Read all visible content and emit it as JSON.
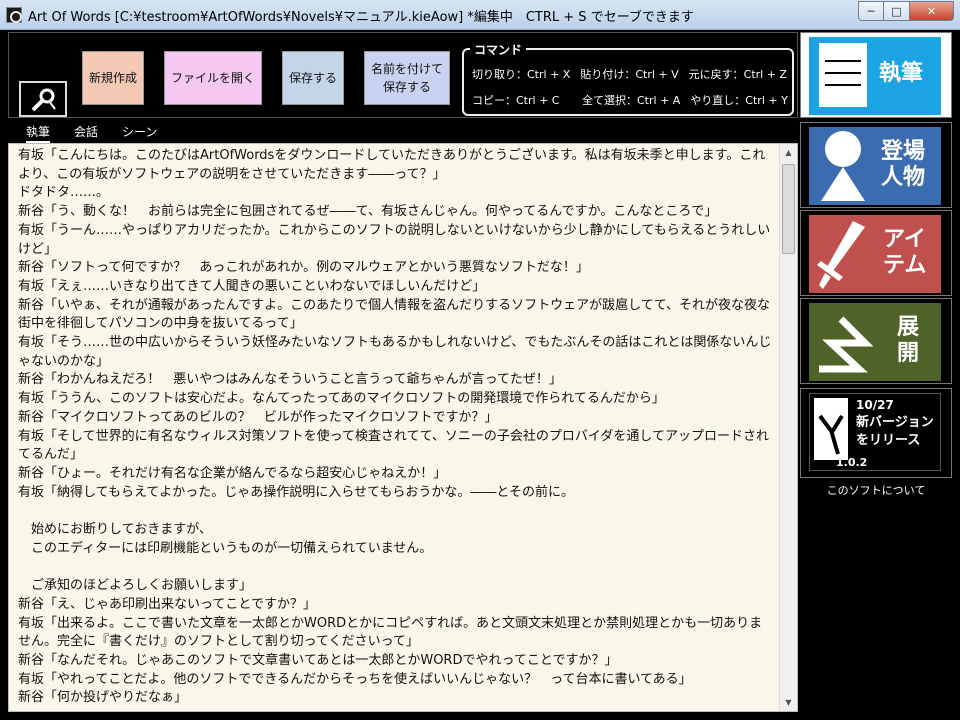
{
  "window": {
    "title": "Art Of Words [C:¥testroom¥ArtOfWords¥Novels¥マニュアル.kieAow] *編集中　CTRL + S でセーブできます",
    "min_label": "─",
    "max_label": "□",
    "close_label": "✕"
  },
  "toolbar": {
    "new_label": "新規作成",
    "open_label": "ファイルを開く",
    "save_label": "保存する",
    "saveas_label": "名前を付けて\n保存する"
  },
  "commands": {
    "title": "コマンド",
    "cut": "切り取り：Ctrl + X",
    "paste": "貼り付け：Ctrl + V",
    "undo": "元に戻す：Ctrl + Z",
    "copy": "コピー：Ctrl + C",
    "select_all": "全て選択：Ctrl + A",
    "redo": "やり直し：Ctrl + Y"
  },
  "tabs": [
    {
      "label": "執筆"
    },
    {
      "label": "会話"
    },
    {
      "label": "シーン"
    }
  ],
  "editor": {
    "text": "有坂「こんにちは。このたびはArtOfWordsをダウンロードしていただきありがとうございます。私は有坂未季と申します。これより、この有坂がソフトウェアの説明をさせていただきます――って？」\nドタドタ……。\n新谷「う、動くな！　お前らは完全に包囲されてるぜ――て、有坂さんじゃん。何やってるんですか。こんなところで」\n有坂「うーん……やっぱりアカリだったか。これからこのソフトの説明しないといけないから少し静かにしてもらえるとうれしいけど」\n新谷「ソフトって何ですか？　あっこれがあれか。例のマルウェアとかいう悪質なソフトだな！」\n有坂「えぇ……いきなり出てきて人聞きの悪いこといわないでほしいんだけど」\n新谷「いやぁ、それが通報があったんですよ。このあたりで個人情報を盗んだりするソフトウェアが跋扈してて、それが夜な夜な街中を徘徊してパソコンの中身を抜いてるって」\n有坂「そう……世の中広いからそういう妖怪みたいなソフトもあるかもしれないけど、でもたぶんその話はこれとは関係ないんじゃないのかな」\n新谷「わかんねえだろ！　悪いやつはみんなそういうこと言うって爺ちゃんが言ってたぜ！」\n有坂「ううん、このソフトは安心だよ。なんてったってあのマイクロソフトの開発環境で作られてるんだから」\n新谷「マイクロソフトってあのビルの？　ビルが作ったマイクロソフトですか？」\n有坂「そして世界的に有名なウィルス対策ソフトを使って検査されてて、ソニーの子会社のプロバイダを通してアップロードされてるんだ」\n新谷「ひょー。それだけ有名な企業が絡んでるなら超安心じゃねえか！」\n有坂「納得してもらえてよかった。じゃあ操作説明に入らせてもらおうかな。――とその前に。\n\n　始めにお断りしておきますが、\n　このエディターには印刷機能というものが一切備えられていません。\n\n　ご承知のほどよろしくお願いします」\n新谷「え、じゃあ印刷出来ないってことですか？」\n有坂「出来るよ。ここで書いた文章を一太郎とかWORDとかにコピペすれば。あと文頭文末処理とか禁則処理とかも一切ありません。完全に『書くだけ』のソフトとして割り切ってくださいって」\n新谷「なんだそれ。じゃあこのソフトで文章書いてあとは一太郎とかWORDでやれってことですか？」\n有坂「やれってことだよ。他のソフトでできるんだからそっちを使えばいいんじゃない？　って台本に書いてある」\n新谷「何か投げやりだなぁ」"
  },
  "side": {
    "write_label": "執筆",
    "chara_label": "登場\n人物",
    "item_label": "アイ\nテム",
    "plot_label": "展\n開",
    "news_date": "10/27",
    "news_text": "新バージョン\nをリリース",
    "news_version": "1.0.2",
    "about_label": "このソフトについて"
  },
  "colors": {
    "write_tile": "#1ca3e4",
    "chara_tile": "#3c6cb0",
    "item_tile": "#c0504d",
    "plot_tile": "#4f6228",
    "editor_bg": "#fbf6ea"
  }
}
